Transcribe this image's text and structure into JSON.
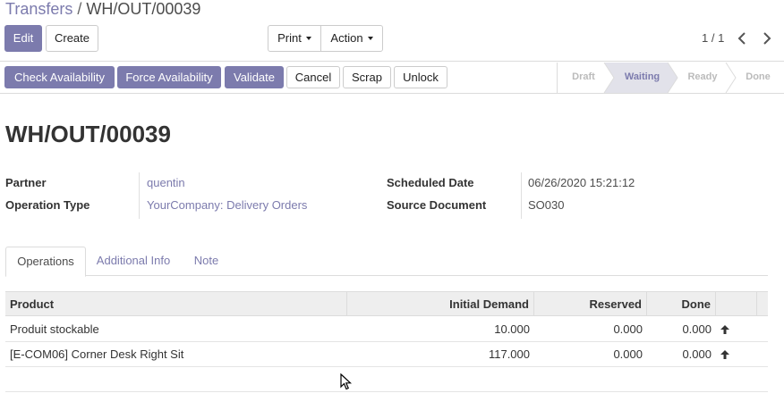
{
  "breadcrumb": {
    "parent": "Transfers",
    "separator": "/",
    "current": "WH/OUT/00039"
  },
  "toolbar": {
    "edit_label": "Edit",
    "create_label": "Create",
    "print_label": "Print",
    "action_label": "Action"
  },
  "pager": {
    "value": "1 / 1",
    "prev_icon": "chevron-left-icon",
    "next_icon": "chevron-right-icon"
  },
  "statusbar": {
    "buttons": [
      "Check Availability",
      "Force Availability",
      "Validate",
      "Cancel",
      "Scrap",
      "Unlock"
    ],
    "states": [
      "Draft",
      "Waiting",
      "Ready",
      "Done"
    ],
    "active_state": "Waiting"
  },
  "record": {
    "title": "WH/OUT/00039",
    "partner_label": "Partner",
    "partner_value": "quentin",
    "operation_type_label": "Operation Type",
    "operation_type_value": "YourCompany: Delivery Orders",
    "scheduled_date_label": "Scheduled Date",
    "scheduled_date_value": "06/26/2020 15:21:12",
    "source_document_label": "Source Document",
    "source_document_value": "SO030"
  },
  "tabs": [
    "Operations",
    "Additional Info",
    "Note"
  ],
  "table": {
    "headers": [
      "Product",
      "Initial Demand",
      "Reserved",
      "Done"
    ],
    "rows": [
      {
        "product": "Produit stockable",
        "demand": "10.000",
        "reserved": "0.000",
        "done": "0.000"
      },
      {
        "product": "[E-COM06] Corner Desk Right Sit",
        "demand": "117.000",
        "reserved": "0.000",
        "done": "0.000"
      }
    ]
  },
  "colors": {
    "accent": "#7c7bad",
    "header_bg": "#eeeeee",
    "active_state_bg": "#e2e2ea"
  }
}
